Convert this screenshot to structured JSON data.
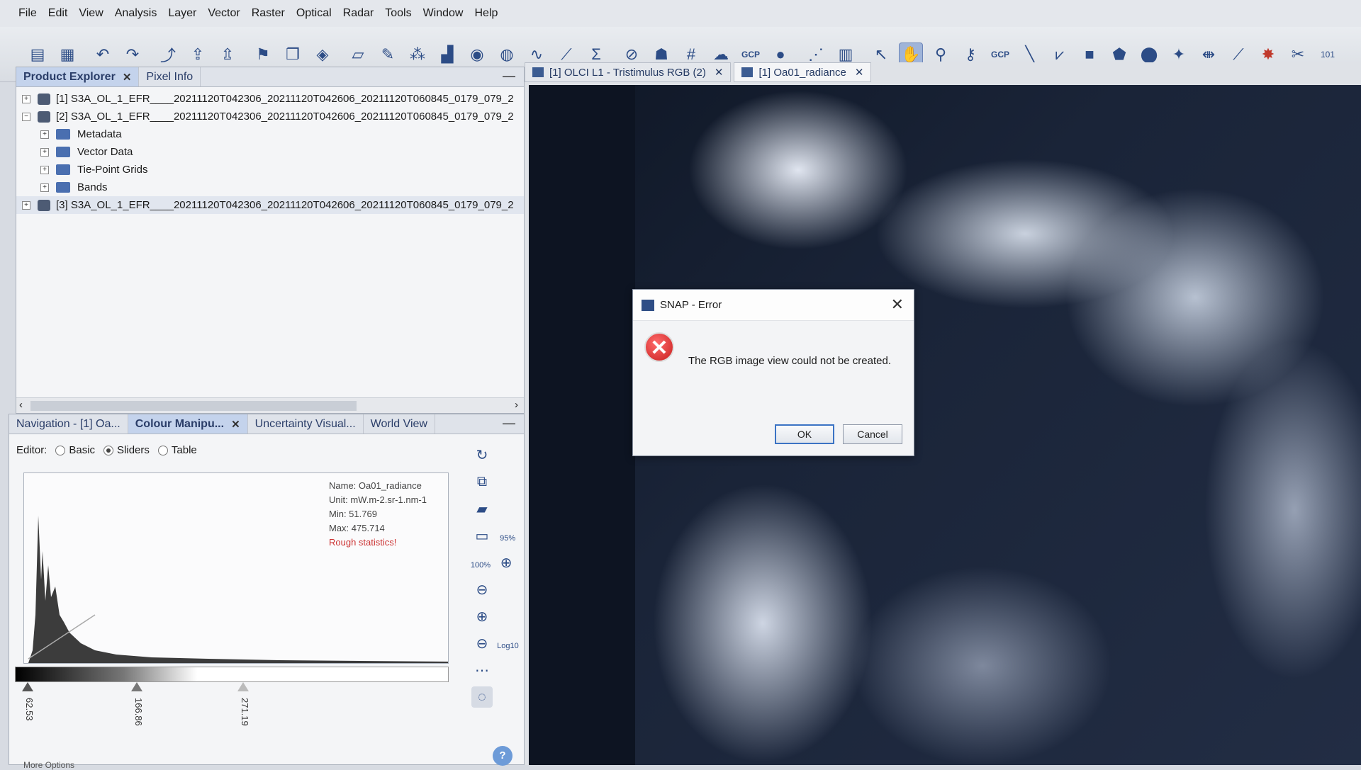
{
  "menu": [
    "File",
    "Edit",
    "View",
    "Analysis",
    "Layer",
    "Vector",
    "Raster",
    "Optical",
    "Radar",
    "Tools",
    "Window",
    "Help"
  ],
  "toolbar": {
    "icons": [
      "open-product-icon",
      "save-product-icon",
      "undo-icon",
      "redo-icon",
      "band-maths-icon",
      "import-icon",
      "export-icon",
      "flag-icon",
      "layer-icon",
      "pin-icon",
      "draw-rect-icon",
      "edit-icon",
      "scatter-icon",
      "histogram-icon",
      "globe-icon",
      "spectrum-icon",
      "profile-icon",
      "statistics-icon",
      "sum-icon",
      "mask-icon",
      "graph-icon",
      "grid-icon",
      "gcp-icon",
      "gcp-manager-icon",
      "time-icon",
      "network-icon",
      "matrix-icon",
      "select-icon",
      "pan-icon",
      "zoom-icon",
      "pin-tool-icon",
      "gcp-tool-icon",
      "line-icon",
      "polyline-icon",
      "rectangle-icon",
      "polygon-icon",
      "ellipse-icon",
      "magic-wand-icon",
      "range-finder-icon",
      "wand-icon",
      "star-icon",
      "cut-icon",
      "binary-icon"
    ],
    "gcp_label": "GCP",
    "gcp_label2": "GCP"
  },
  "product_explorer": {
    "tabs": [
      {
        "label": "Product Explorer",
        "closable": true
      },
      {
        "label": "Pixel Info",
        "closable": false
      }
    ],
    "rows": [
      {
        "label": "[1] S3A_OL_1_EFR____20211120T042306_20211120T042606_20211120T060845_0179_079_2"
      },
      {
        "label": "[2] S3A_OL_1_EFR____20211120T042306_20211120T042606_20211120T060845_0179_079_2"
      },
      {
        "label": "Metadata"
      },
      {
        "label": "Vector Data"
      },
      {
        "label": "Tie-Point Grids"
      },
      {
        "label": "Bands"
      },
      {
        "label": "[3] S3A_OL_1_EFR____20211120T042306_20211120T042606_20211120T060845_0179_079_2"
      }
    ]
  },
  "bottom_panel": {
    "tabs": [
      {
        "label": "Navigation - [1] Oa...",
        "closable": false
      },
      {
        "label": "Colour Manipu...",
        "closable": true
      },
      {
        "label": "Uncertainty Visual...",
        "closable": false
      },
      {
        "label": "World View",
        "closable": false
      }
    ],
    "editor_label": "Editor:",
    "editor_options": [
      "Basic",
      "Sliders",
      "Table"
    ],
    "editor_selected": "Sliders",
    "stats": {
      "name": "Name: Oa01_radiance",
      "unit": "Unit: mW.m-2.sr-1.nm-1",
      "min": "Min: 51.769",
      "max": "Max: 475.714",
      "note": "Rough statistics!"
    },
    "slider_values": [
      "62.53",
      "166.86",
      "271.19"
    ],
    "side_labels": {
      "p95": "95%",
      "p100": "100%",
      "log": "Log10"
    },
    "more_options": "More Options"
  },
  "document_tabs": [
    {
      "label": "[1] OLCI L1 - Tristimulus RGB (2)"
    },
    {
      "label": "[1] Oa01_radiance"
    }
  ],
  "dialog": {
    "title": "SNAP - Error",
    "message": "The RGB image view could not be created.",
    "ok_label": "OK",
    "cancel_label": "Cancel"
  }
}
